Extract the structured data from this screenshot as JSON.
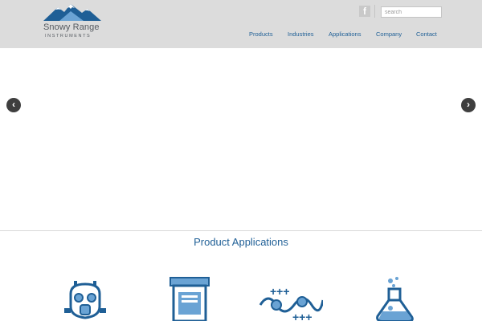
{
  "brand": {
    "name": "Snowy Range",
    "subtitle": "INSTRUMENTS",
    "colors": {
      "dark": "#1f5f96",
      "light": "#6aa3d4"
    }
  },
  "header": {
    "social_icon": "facebook-icon",
    "social_glyph": "f",
    "search_placeholder": "search"
  },
  "nav": {
    "items": [
      {
        "label": "Products"
      },
      {
        "label": "Industries"
      },
      {
        "label": "Applications"
      },
      {
        "label": "Company"
      },
      {
        "label": "Contact"
      }
    ]
  },
  "slider": {
    "prev_glyph": "‹",
    "next_glyph": "›",
    "prev_icon": "chevron-left-icon",
    "next_icon": "chevron-right-icon"
  },
  "applications": {
    "title": "Product Applications",
    "icons": [
      "gas-mask-icon",
      "pill-bottle-icon",
      "polymer-chain-icon",
      "flask-icon"
    ]
  }
}
